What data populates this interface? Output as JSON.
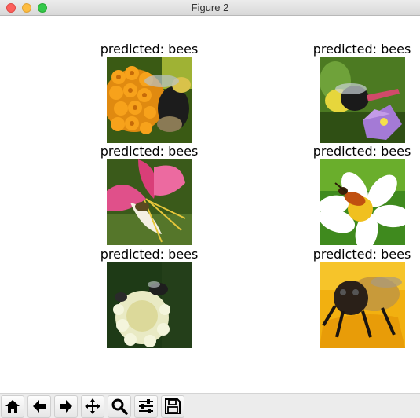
{
  "window": {
    "title": "Figure 2"
  },
  "figure": {
    "panels": [
      {
        "title": "predicted: bees"
      },
      {
        "title": "predicted: bees"
      },
      {
        "title": "predicted: bees"
      },
      {
        "title": "predicted: bees"
      },
      {
        "title": "predicted: bees"
      },
      {
        "title": "predicted: bees"
      }
    ]
  },
  "toolbar": {
    "buttons": [
      {
        "name": "home-button",
        "icon": "home-icon"
      },
      {
        "name": "back-button",
        "icon": "arrow-left-icon"
      },
      {
        "name": "forward-button",
        "icon": "arrow-right-icon"
      },
      {
        "name": "pan-button",
        "icon": "move-icon"
      },
      {
        "name": "zoom-button",
        "icon": "magnifier-icon"
      },
      {
        "name": "configure-subplots-button",
        "icon": "sliders-icon"
      },
      {
        "name": "save-button",
        "icon": "floppy-disk-icon"
      }
    ]
  }
}
